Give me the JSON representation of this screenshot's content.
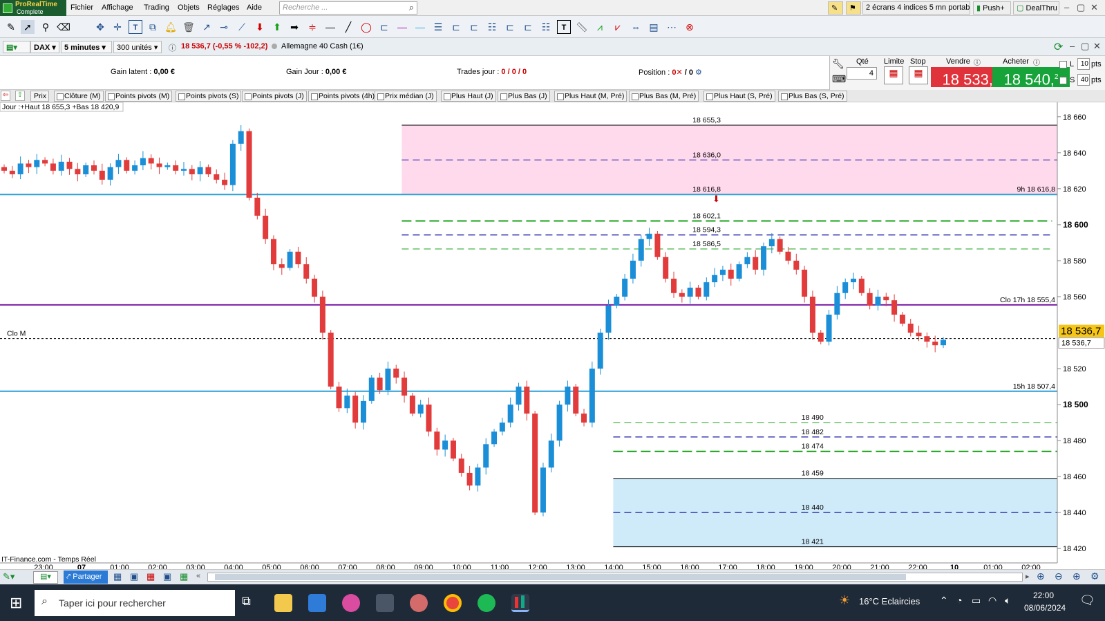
{
  "app": {
    "name_line1": "ProRealTime",
    "name_line2": "Complete"
  },
  "menu": [
    "Fichier",
    "Affichage",
    "Trading",
    "Objets",
    "Réglages",
    "Aide"
  ],
  "search_placeholder": "Recherche ...",
  "right_buttons": {
    "screen_preset": "2 écrans 4 indices 5 mn portab",
    "push": "Push+",
    "dealthru": "DealThru"
  },
  "instrument": {
    "symbol": "DAX",
    "timeframe": "5 minutes",
    "units": "300 unités",
    "quote": "18 536,7 (-0,55 % -102,2)",
    "name": "Allemagne 40 Cash (1€)"
  },
  "order": {
    "gain_latent_label": "Gain latent :",
    "gain_latent": "0,00 €",
    "gain_jour_label": "Gain Jour :",
    "gain_jour": "0,00 €",
    "trades_label": "Trades jour :",
    "trades": "0 / 0 / 0",
    "position_label": "Position :",
    "position": "0",
    "position2": "/ 0",
    "qte_label": "Qté",
    "qte": "4",
    "limite_label": "Limite",
    "stop_label": "Stop",
    "vendre_label": "Vendre",
    "acheter_label": "Acheter",
    "sell_price": "18 533,",
    "sell_sup": "2",
    "buy_price": "18 540,",
    "buy_sup": "2",
    "l_label": "L",
    "l_val": "10",
    "s_label": "S",
    "s_val": "40",
    "pts": "pts"
  },
  "filters": [
    "Prix",
    "Clôture (M)",
    "Points pivots (M)",
    "Points pivots (S)",
    "Points pivots (J)",
    "Points pivots (4h)",
    "Prix médian (J)",
    "Plus Haut (J)",
    "Plus Bas (J)",
    "Plus Haut (M, Pré)",
    "Plus Bas (M, Pré)",
    "Plus Haut (S, Pré)",
    "Plus Bas (S, Pré)"
  ],
  "chart_data": {
    "type": "candlestick",
    "info_label": "Jour :+Haut 18 655,3 +Bas 18 420,9",
    "source": "IT-Finance.com - Temps Réel",
    "ylim": [
      18412,
      18668
    ],
    "y_ticks": [
      {
        "v": 18660,
        "t": "18 660"
      },
      {
        "v": 18640,
        "t": "18 640"
      },
      {
        "v": 18620,
        "t": "18 620"
      },
      {
        "v": 18600,
        "t": "18 600",
        "bold": true
      },
      {
        "v": 18580,
        "t": "18 580"
      },
      {
        "v": 18560,
        "t": "18 560"
      },
      {
        "v": 18520,
        "t": "18 520"
      },
      {
        "v": 18500,
        "t": "18 500",
        "bold": true
      },
      {
        "v": 18480,
        "t": "18 480"
      },
      {
        "v": 18460,
        "t": "18 460"
      },
      {
        "v": 18440,
        "t": "18 440"
      },
      {
        "v": 18420,
        "t": "18 420"
      }
    ],
    "x_ticks": [
      {
        "i": 0,
        "t": "23:00"
      },
      {
        "i": 1,
        "t": "07",
        "bold": true
      },
      {
        "i": 2,
        "t": "01:00"
      },
      {
        "i": 3,
        "t": "02:00"
      },
      {
        "i": 4,
        "t": "03:00"
      },
      {
        "i": 5,
        "t": "04:00"
      },
      {
        "i": 6,
        "t": "05:00"
      },
      {
        "i": 7,
        "t": "06:00"
      },
      {
        "i": 8,
        "t": "07:00"
      },
      {
        "i": 9,
        "t": "08:00"
      },
      {
        "i": 10,
        "t": "09:00"
      },
      {
        "i": 11,
        "t": "10:00"
      },
      {
        "i": 12,
        "t": "11:00"
      },
      {
        "i": 13,
        "t": "12:00"
      },
      {
        "i": 14,
        "t": "13:00"
      },
      {
        "i": 15,
        "t": "14:00"
      },
      {
        "i": 16,
        "t": "15:00"
      },
      {
        "i": 17,
        "t": "16:00"
      },
      {
        "i": 18,
        "t": "17:00"
      },
      {
        "i": 19,
        "t": "18:00"
      },
      {
        "i": 20,
        "t": "19:00"
      },
      {
        "i": 21,
        "t": "20:00"
      },
      {
        "i": 22,
        "t": "21:00"
      },
      {
        "i": 23,
        "t": "22:00"
      },
      {
        "i": 24,
        "t": "10",
        "bold": true
      },
      {
        "i": 25,
        "t": "01:00"
      },
      {
        "i": 26,
        "t": "02:00"
      }
    ],
    "close_series": [
      18630,
      18628,
      18634,
      18632,
      18636,
      18634,
      18630,
      18635,
      18631,
      18628,
      18633,
      18630,
      18625,
      18632,
      18636,
      18630,
      18633,
      18637,
      18634,
      18632,
      18633,
      18630,
      18631,
      18628,
      18632,
      18628,
      18625,
      18622,
      18645,
      18652,
      18615,
      18605,
      18592,
      18578,
      18576,
      18585,
      18578,
      18570,
      18560,
      18540,
      18510,
      18498,
      18505,
      18490,
      18502,
      18515,
      18508,
      18520,
      18515,
      18505,
      18495,
      18500,
      18485,
      18475,
      18480,
      18470,
      18462,
      18455,
      18465,
      18478,
      18485,
      18490,
      18500,
      18510,
      18495,
      18440,
      18465,
      18480,
      18500,
      18510,
      18495,
      18490,
      18520,
      18540,
      18555,
      18560,
      18570,
      18580,
      18592,
      18595,
      18582,
      18570,
      18562,
      18560,
      18565,
      18560,
      18568,
      18572,
      18575,
      18570,
      18578,
      18582,
      18575,
      18588,
      18592,
      18585,
      18580,
      18575,
      18560,
      18540,
      18535,
      18550,
      18562,
      18568,
      18570,
      18562,
      18555,
      18560,
      18558,
      18550,
      18545,
      18540,
      18538,
      18535,
      18533,
      18536
    ],
    "last_price": "18 536,7",
    "h_lines": [
      {
        "v": 18669,
        "color": "#d40000",
        "dash": "14,8",
        "w": 2,
        "start": 0.76
      },
      {
        "v": 18655.3,
        "color": "#000",
        "w": 1,
        "start": 0.38,
        "label": "18 655,3",
        "lx": 0.655
      },
      {
        "v": 18636.0,
        "color": "#1a1aa8",
        "dash": "10,6",
        "w": 1,
        "start": 0.38,
        "label": "18 636,0",
        "lx": 0.655
      },
      {
        "v": 18616.8,
        "color": "#29a0d8",
        "w": 2,
        "start": 0,
        "label": "18 616,8",
        "lx": 0.655,
        "rlabel": "9h 18 616,8"
      },
      {
        "v": 18602.1,
        "color": "#17a117",
        "dash": "14,6",
        "w": 2,
        "start": 0.38,
        "end": 0.995,
        "label": "18 602,1",
        "lx": 0.655
      },
      {
        "v": 18594.3,
        "color": "#1a1aa8",
        "dash": "10,6",
        "w": 1.3,
        "start": 0.38,
        "end": 0.995,
        "label": "18 594,3",
        "lx": 0.655
      },
      {
        "v": 18586.5,
        "color": "#17a117",
        "dash": "10,6",
        "w": 1,
        "start": 0.38,
        "end": 0.995,
        "label": "18 586,5",
        "lx": 0.655
      },
      {
        "v": 18555.4,
        "color": "#7a1fa8",
        "w": 2,
        "start": 0,
        "rlabel": "Clo 17h 18 555,4"
      },
      {
        "v": 18536.7,
        "color": "#000",
        "dash": "3,3",
        "w": 1,
        "start": 0,
        "llabel": "Clo M"
      },
      {
        "v": 18507.4,
        "color": "#29a0d8",
        "w": 2,
        "start": 0,
        "rlabel": "15h 18 507,4"
      },
      {
        "v": 18490,
        "color": "#17a117",
        "dash": "10,6",
        "w": 1,
        "start": 0.58,
        "label": "18 490",
        "lx": 0.758
      },
      {
        "v": 18482,
        "color": "#1a1aa8",
        "dash": "10,6",
        "w": 1.3,
        "start": 0.58,
        "label": "18 482",
        "lx": 0.758
      },
      {
        "v": 18474,
        "color": "#17a117",
        "dash": "14,6",
        "w": 2,
        "start": 0.58,
        "label": "18 474",
        "lx": 0.758
      },
      {
        "v": 18459,
        "color": "#000",
        "w": 1,
        "start": 0.58,
        "label": "18 459",
        "lx": 0.758
      },
      {
        "v": 18440,
        "color": "#1a1aa8",
        "dash": "10,6",
        "w": 1.3,
        "start": 0.58,
        "label": "18 440",
        "lx": 0.758
      },
      {
        "v": 18421,
        "color": "#000",
        "w": 1,
        "start": 0.58,
        "label": "18 421",
        "lx": 0.758
      }
    ],
    "zones": [
      {
        "from": 18616.8,
        "to": 18655.3,
        "start": 0.38,
        "color": "#ffd9ec"
      },
      {
        "from": 18421,
        "to": 18459,
        "start": 0.58,
        "color": "#cfeaf9"
      }
    ]
  },
  "bottom": {
    "share": "Partager"
  },
  "taskbar": {
    "search": "Taper ici pour rechercher",
    "weather": "16°C  Eclaircies",
    "time": "22:00",
    "date": "08/06/2024"
  }
}
